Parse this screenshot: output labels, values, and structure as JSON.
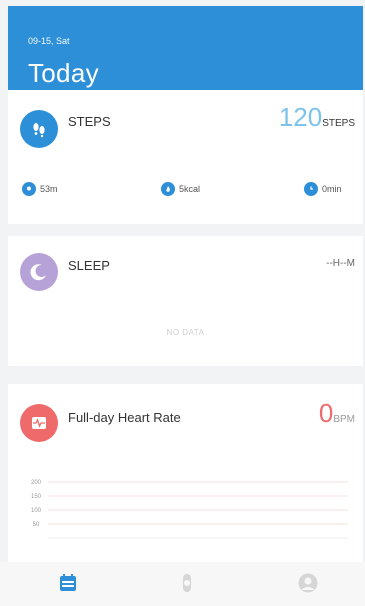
{
  "header": {
    "date": "09-15, Sat",
    "title": "Today"
  },
  "steps": {
    "title": "STEPS",
    "subtitle": "",
    "value": "120",
    "unit": "STEPS",
    "value_sub": "",
    "stats": [
      {
        "icon": "location-icon",
        "value": "53m"
      },
      {
        "icon": "flame-icon",
        "value": "5kcal"
      },
      {
        "icon": "clock-icon",
        "value": "0min"
      }
    ]
  },
  "sleep": {
    "title": "SLEEP",
    "subtitle": "",
    "value": "--H--M",
    "value_sub": "",
    "no_data": "NO DATA"
  },
  "heart": {
    "title": "Full-day Heart Rate",
    "subtitle": "",
    "value": "0",
    "unit": "BPM",
    "value_sub": "",
    "y_ticks": [
      "200",
      "150",
      "100",
      "50"
    ]
  },
  "tabs": [
    {
      "name": "tab-today",
      "icon": "calendar-icon",
      "active": true
    },
    {
      "name": "tab-device",
      "icon": "watch-icon",
      "active": false
    },
    {
      "name": "tab-profile",
      "icon": "user-icon",
      "active": false
    }
  ],
  "colors": {
    "accent": "#2d8fd8",
    "sleep": "#b7a2d8",
    "heart": "#ef6b6b"
  }
}
